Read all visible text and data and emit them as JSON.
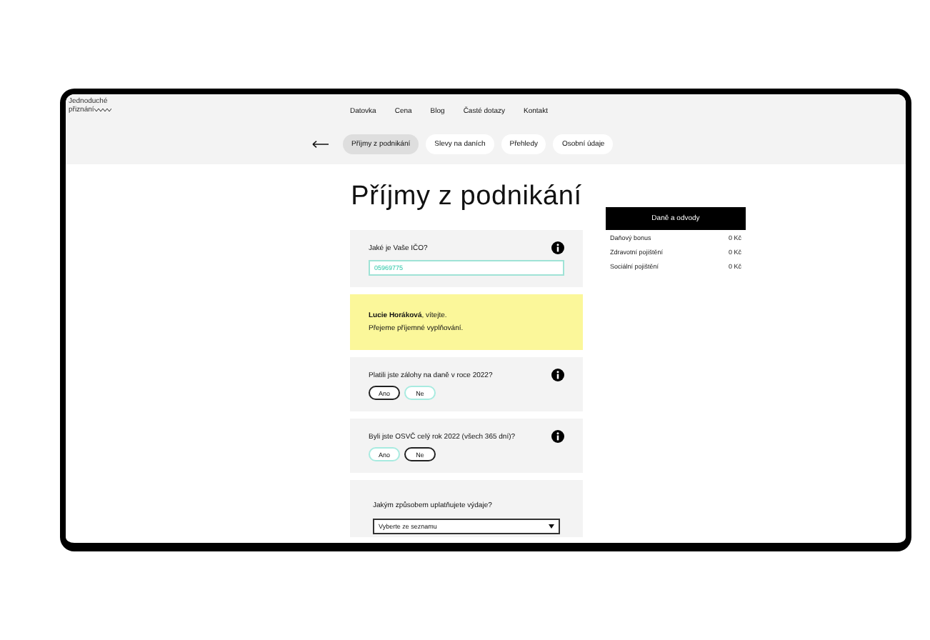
{
  "logo": {
    "lines": [
      "Jednoduché",
      "přiznání"
    ]
  },
  "nav": [
    "Datovka",
    "Cena",
    "Blog",
    "Časté dotazy",
    "Kontakt"
  ],
  "tabs": [
    {
      "label": "Příjmy z podnikání",
      "selected": true
    },
    {
      "label": "Slevy na daních",
      "selected": false
    },
    {
      "label": "Přehledy",
      "selected": false
    },
    {
      "label": "Osobní údaje",
      "selected": false
    }
  ],
  "page_title": "Příjmy z podnikání",
  "ico_card": {
    "question": "Jaké je Vaše IČO?",
    "value": "05969775"
  },
  "welcome": {
    "lines": [
      "**Lucie Horáková**, vítejte.",
      "Přejeme příjemné vyplňování."
    ]
  },
  "questions": [
    {
      "question": "Platili jste zálohy na daně v roce 2022?",
      "options": [
        {
          "label": "Ano",
          "selected": false
        },
        {
          "label": "Ne",
          "selected": true
        }
      ]
    },
    {
      "question": "Byli jste OSVČ celý rok 2022 (všech 365 dní)?",
      "options": [
        {
          "label": "Ano",
          "selected": true
        },
        {
          "label": "Ne",
          "selected": false
        }
      ]
    }
  ],
  "expenses": {
    "question": "Jakým způsobem uplatňujete výdaje?",
    "value": "Vyberte ze seznamu"
  },
  "sidebar": {
    "title": "Daně a odvody",
    "rows": [
      {
        "label": "Daňový bonus",
        "value": "0 Kč"
      },
      {
        "label": "Zdravotní pojištění",
        "value": "0 Kč"
      },
      {
        "label": "Sociální pojištění",
        "value": "0 Kč"
      }
    ]
  }
}
